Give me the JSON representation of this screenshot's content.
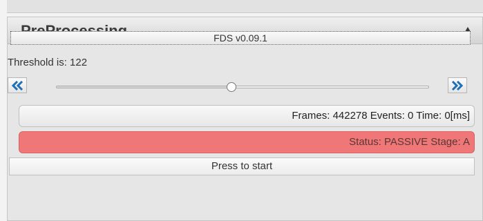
{
  "panel": {
    "title": "PreProcessing",
    "collapse_icon": "double-chevron-up-icon"
  },
  "version_button": {
    "label": "FDS v0.09.1"
  },
  "threshold": {
    "label": "Threshold is: 122",
    "value": 122,
    "slider_level": 0.47,
    "left_icon": "double-chevron-left-icon",
    "right_icon": "double-chevron-right-icon"
  },
  "stats": {
    "text": "Frames: 442278 Events: 0 Time: 0[ms]"
  },
  "status": {
    "text": "Status: PASSIVE Stage: A",
    "color": "#f07777"
  },
  "start_button": {
    "label": "Press to start"
  },
  "colors": {
    "arrow_blue": "#1e6fb8"
  }
}
